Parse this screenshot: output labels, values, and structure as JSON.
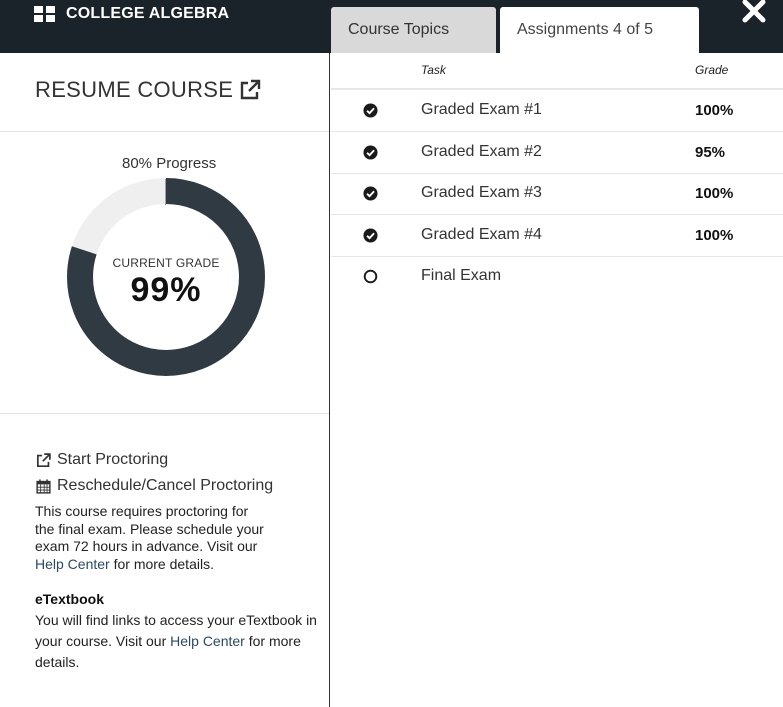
{
  "header": {
    "title": "COLLEGE ALGEBRA",
    "tabs": [
      {
        "label": "Course Topics",
        "active": false
      },
      {
        "label": "Assignments 4 of 5",
        "active": true
      }
    ]
  },
  "sidebar": {
    "resume_label": "RESUME COURSE",
    "progress_label": "80% Progress",
    "progress_fraction": 0.8,
    "grade_caption": "CURRENT GRADE",
    "grade_value": "99%",
    "start_proctoring": "Start Proctoring",
    "reschedule": "Reschedule/Cancel Proctoring",
    "note_lines": [
      "This course requires proctoring for",
      "the final exam. Please schedule your",
      "exam 72 hours in advance. Visit our"
    ],
    "note_link": "Help Center",
    "note_tail": " for more details.",
    "etextbook_title": "eTextbook",
    "etextbook_text": "You will find links to access your eTextbook in your course. Visit our ",
    "etextbook_link": "Help Center",
    "etextbook_tail": " for more details."
  },
  "table": {
    "headers": {
      "task": "Task",
      "grade": "Grade"
    },
    "rows": [
      {
        "task": "Graded Exam #1",
        "grade": "100%",
        "completed": true
      },
      {
        "task": "Graded Exam #2",
        "grade": "95%",
        "completed": true
      },
      {
        "task": "Graded Exam #3",
        "grade": "100%",
        "completed": true
      },
      {
        "task": "Graded Exam #4",
        "grade": "100%",
        "completed": true
      },
      {
        "task": "Final Exam",
        "grade": "",
        "completed": false
      }
    ]
  },
  "colors": {
    "topbar": "#1b232a",
    "donut_fill": "#2f3a43",
    "donut_track": "#efefef"
  }
}
